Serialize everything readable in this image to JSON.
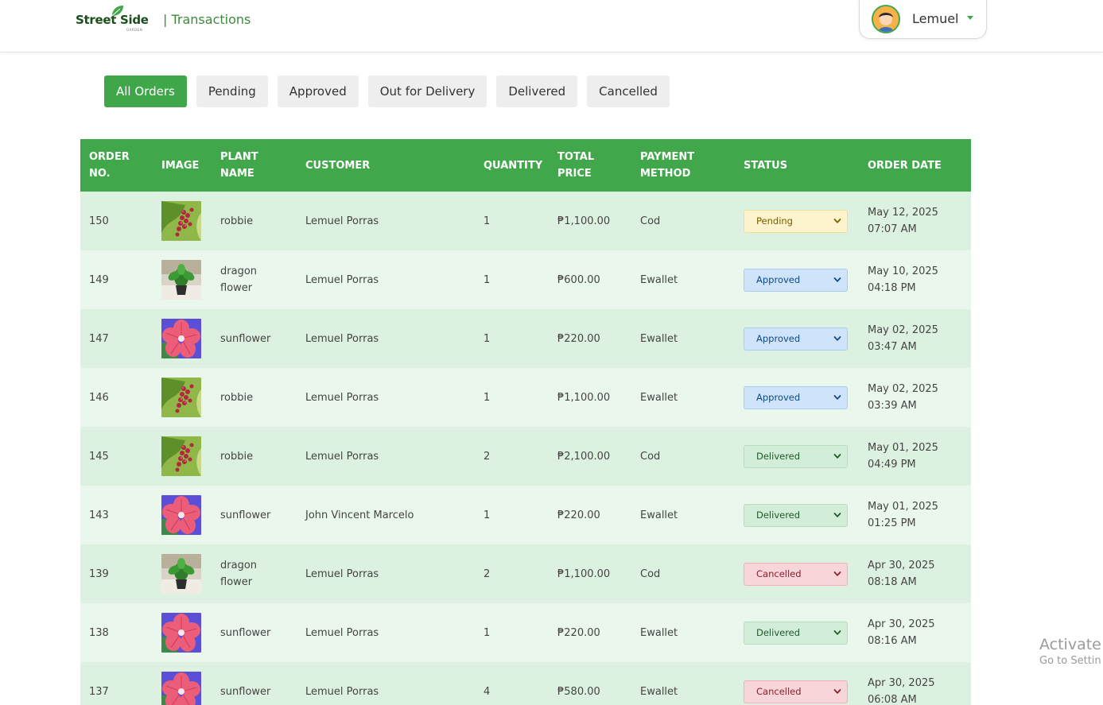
{
  "header": {
    "brand": "Street Side",
    "brand_sub": "GARDEN",
    "page_title": "| Transactions",
    "user_name": "Lemuel"
  },
  "tabs": [
    {
      "label": "All Orders",
      "active": true
    },
    {
      "label": "Pending",
      "active": false
    },
    {
      "label": "Approved",
      "active": false
    },
    {
      "label": "Out for Delivery",
      "active": false
    },
    {
      "label": "Delivered",
      "active": false
    },
    {
      "label": "Cancelled",
      "active": false
    }
  ],
  "table": {
    "headers": [
      "ORDER NO.",
      "IMAGE",
      "PLANT NAME",
      "CUSTOMER",
      "QUANTITY",
      "TOTAL PRICE",
      "PAYMENT METHOD",
      "STATUS",
      "ORDER DATE"
    ],
    "rows": [
      {
        "order_no": "150",
        "image": "red-berry-plant",
        "plant": "robbie",
        "customer": "Lemuel Porras",
        "quantity": "1",
        "total": "₱1,100.00",
        "payment": "Cod",
        "status": "Pending",
        "date": "May 12, 2025 07:07 AM"
      },
      {
        "order_no": "149",
        "image": "potted-green-plant",
        "plant": "dragon flower",
        "customer": "Lemuel Porras",
        "quantity": "1",
        "total": "₱600.00",
        "payment": "Ewallet",
        "status": "Approved",
        "date": "May 10, 2025 04:18 PM"
      },
      {
        "order_no": "147",
        "image": "pink-hibiscus",
        "plant": "sunflower",
        "customer": "Lemuel Porras",
        "quantity": "1",
        "total": "₱220.00",
        "payment": "Ewallet",
        "status": "Approved",
        "date": "May 02, 2025 03:47 AM"
      },
      {
        "order_no": "146",
        "image": "red-berry-plant",
        "plant": "robbie",
        "customer": "Lemuel Porras",
        "quantity": "1",
        "total": "₱1,100.00",
        "payment": "Ewallet",
        "status": "Approved",
        "date": "May 02, 2025 03:39 AM"
      },
      {
        "order_no": "145",
        "image": "red-berry-plant",
        "plant": "robbie",
        "customer": "Lemuel Porras",
        "quantity": "2",
        "total": "₱2,100.00",
        "payment": "Cod",
        "status": "Delivered",
        "date": "May 01, 2025 04:49 PM"
      },
      {
        "order_no": "143",
        "image": "pink-hibiscus",
        "plant": "sunflower",
        "customer": "John Vincent Marcelo",
        "quantity": "1",
        "total": "₱220.00",
        "payment": "Ewallet",
        "status": "Delivered",
        "date": "May 01, 2025 01:25 PM"
      },
      {
        "order_no": "139",
        "image": "potted-green-plant",
        "plant": "dragon flower",
        "customer": "Lemuel Porras",
        "quantity": "2",
        "total": "₱1,100.00",
        "payment": "Cod",
        "status": "Cancelled",
        "date": "Apr 30, 2025 08:18 AM"
      },
      {
        "order_no": "138",
        "image": "pink-hibiscus",
        "plant": "sunflower",
        "customer": "Lemuel Porras",
        "quantity": "1",
        "total": "₱220.00",
        "payment": "Ewallet",
        "status": "Delivered",
        "date": "Apr 30, 2025 08:16 AM"
      },
      {
        "order_no": "137",
        "image": "pink-hibiscus",
        "plant": "sunflower",
        "customer": "Lemuel Porras",
        "quantity": "4",
        "total": "₱580.00",
        "payment": "Ewallet",
        "status": "Cancelled",
        "date": "Apr 30, 2025 06:08 AM"
      }
    ]
  },
  "colors": {
    "accent": "#40a84a",
    "row_odd": "#dcf1df",
    "row_even": "#eaf7ec",
    "pending": "#fdf3cd",
    "approved": "#cfe4fb",
    "delivered": "#d2edd8",
    "cancelled": "#f8d5d9"
  },
  "watermark": {
    "line1": "Activate W",
    "line2": "Go to Settin"
  }
}
